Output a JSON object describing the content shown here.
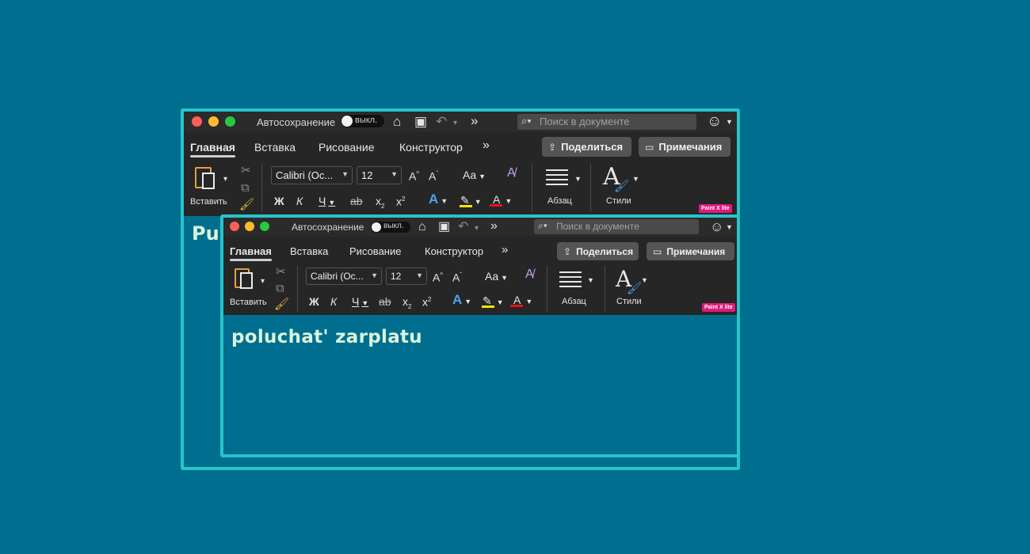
{
  "windows": [
    {
      "autosave_label": "Автосохранение",
      "toggle_label": "выкл.",
      "search_placeholder": "Поиск в документе",
      "tabs": [
        "Главная",
        "Вставка",
        "Рисование",
        "Конструктор",
        "»"
      ],
      "share_label": "Поделиться",
      "comments_label": "Примечания",
      "paste_label": "Вставить",
      "font_name": "Calibri (Ос...",
      "font_size": "12",
      "bold": "Ж",
      "italic": "К",
      "underline": "Ч",
      "strike": "ab",
      "case": "Aa",
      "paragraph_label": "Абзац",
      "styles_label": "Стили",
      "badge": "Paint X lite",
      "doc_text": "Pup"
    },
    {
      "autosave_label": "Автосохранение",
      "toggle_label": "выкл.",
      "search_placeholder": "Поиск в документе",
      "tabs": [
        "Главная",
        "Вставка",
        "Рисование",
        "Конструктор",
        "»"
      ],
      "share_label": "Поделиться",
      "comments_label": "Примечания",
      "paste_label": "Вставить",
      "font_name": "Calibri (Ос...",
      "font_size": "12",
      "bold": "Ж",
      "italic": "К",
      "underline": "Ч",
      "strike": "ab",
      "case": "Aa",
      "paragraph_label": "Абзац",
      "styles_label": "Стили",
      "badge": "Paint X lite",
      "doc_text": "poluchat'  zarplatu"
    }
  ],
  "colors": {
    "desktop": "#006e8e",
    "window_border": "#27c4cc",
    "ribbon_bg": "#262626",
    "highlight_bar": "#f4e400",
    "font_color_bar": "#e3141d",
    "doc_text": "#d8f5dd"
  },
  "icons": {
    "home": "home-icon",
    "save": "save-icon",
    "undo": "undo-icon",
    "more": "chevron-double-right-icon",
    "search": "search-icon",
    "feedback": "smiley-icon"
  }
}
